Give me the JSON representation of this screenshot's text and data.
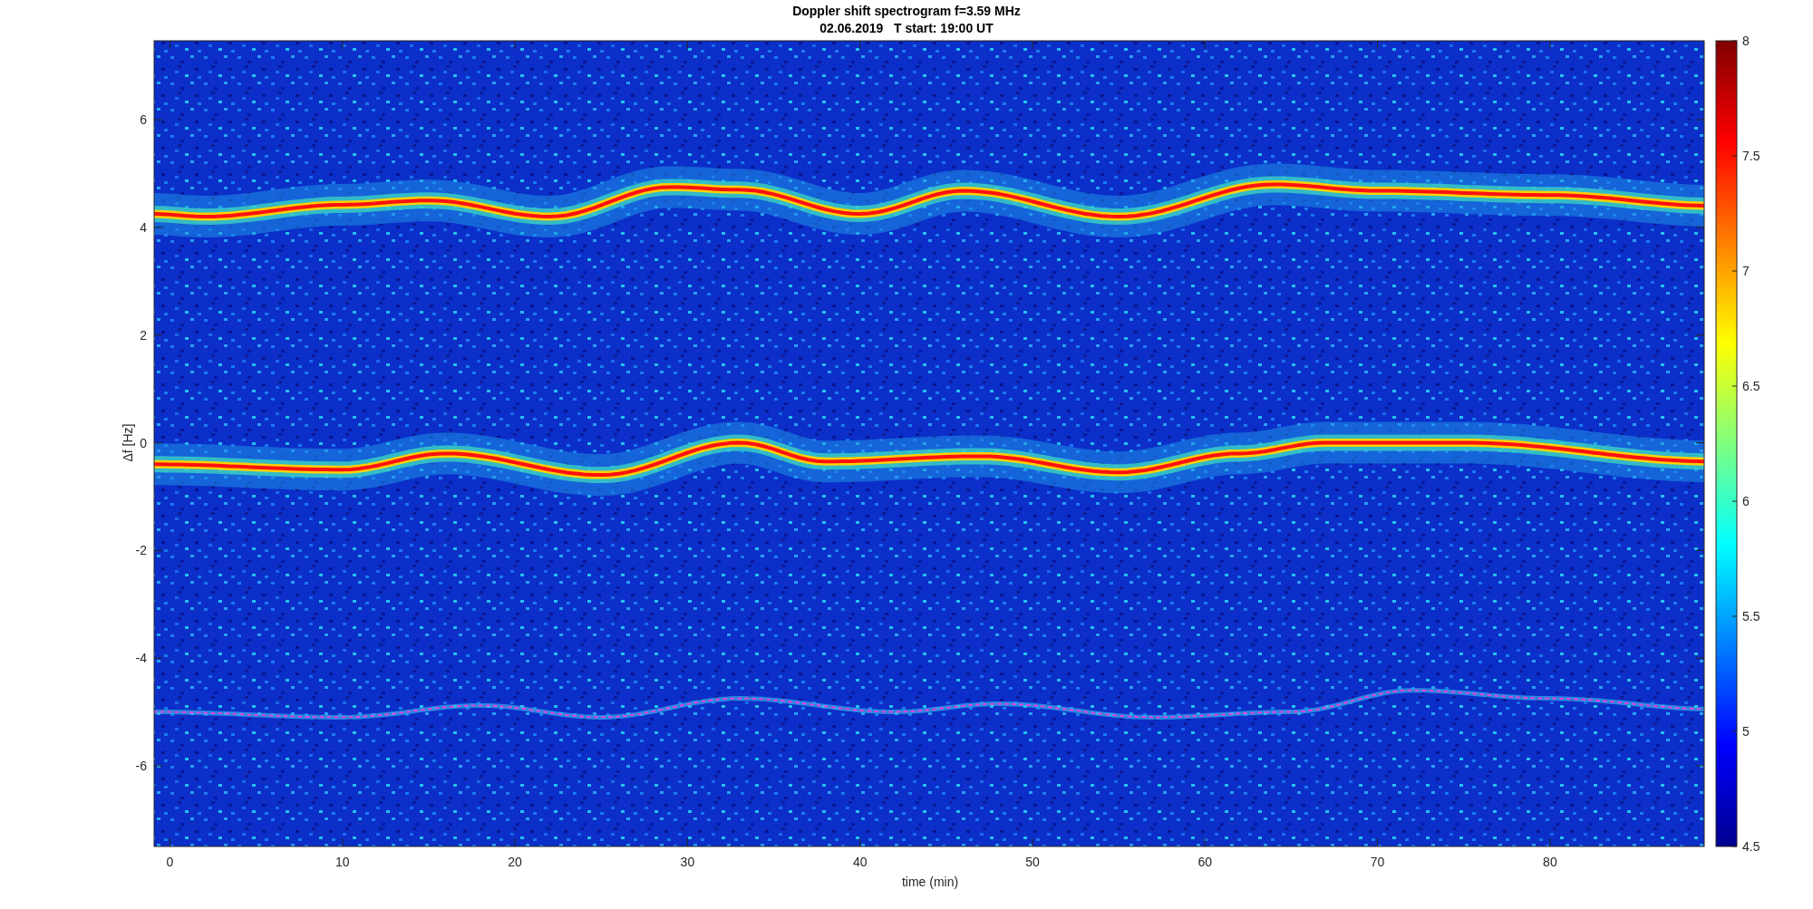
{
  "figure": {
    "title": "Doppler shift spectrogram f=3.59 MHz",
    "subtitle": "02.06.2019   T start: 19:00 UT",
    "xlabel": "time (min)",
    "ylabel": "Δf [Hz]",
    "xtick_labels": [
      "0",
      "10",
      "20",
      "30",
      "40",
      "50",
      "60",
      "70",
      "80"
    ],
    "ytick_labels": [
      "6",
      "4",
      "2",
      "0",
      "-2",
      "-4",
      "-6"
    ],
    "colorbar_tick_labels": [
      "8",
      "7.5",
      "7",
      "6.5",
      "6",
      "5.5",
      "5",
      "4.5"
    ]
  }
}
